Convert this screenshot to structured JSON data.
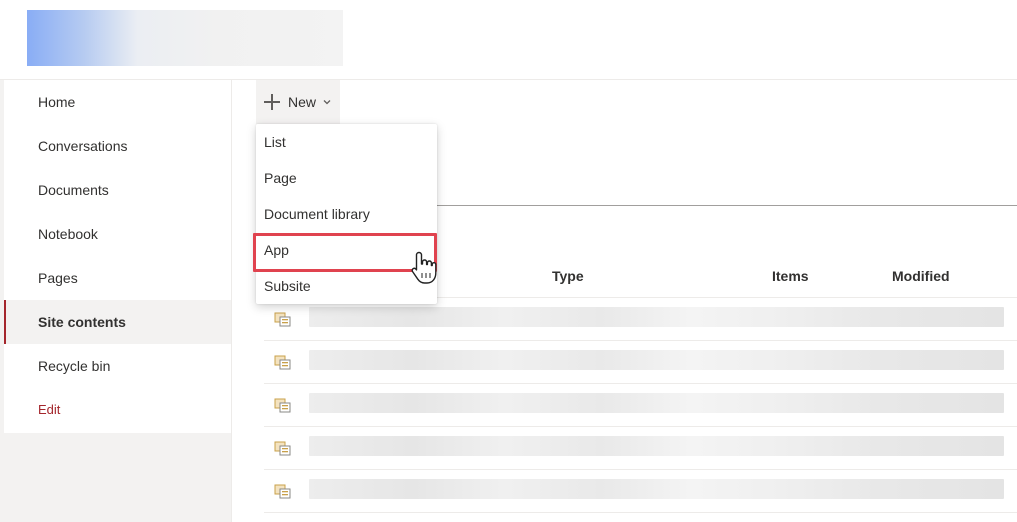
{
  "sidebar": {
    "items": [
      {
        "label": "Home"
      },
      {
        "label": "Conversations"
      },
      {
        "label": "Documents"
      },
      {
        "label": "Notebook"
      },
      {
        "label": "Pages"
      },
      {
        "label": "Site contents"
      },
      {
        "label": "Recycle bin"
      },
      {
        "label": "Edit"
      }
    ],
    "active_item": "Site contents"
  },
  "toolbar": {
    "new_label": "New",
    "new_icon": "plus-icon",
    "chevron_icon": "chevron-down-icon"
  },
  "new_menu": {
    "items": [
      {
        "label": "List"
      },
      {
        "label": "Page"
      },
      {
        "label": "Document library"
      },
      {
        "label": "App"
      },
      {
        "label": "Subsite"
      }
    ],
    "highlighted_item": "App"
  },
  "table": {
    "columns": [
      "Type",
      "Items",
      "Modified"
    ],
    "row_icon": "library-app-icon",
    "row_count": 5
  },
  "colors": {
    "accent": "#a4262c",
    "highlight_box": "#e0434f",
    "nav_selected_bg": "#f3f2f1"
  }
}
